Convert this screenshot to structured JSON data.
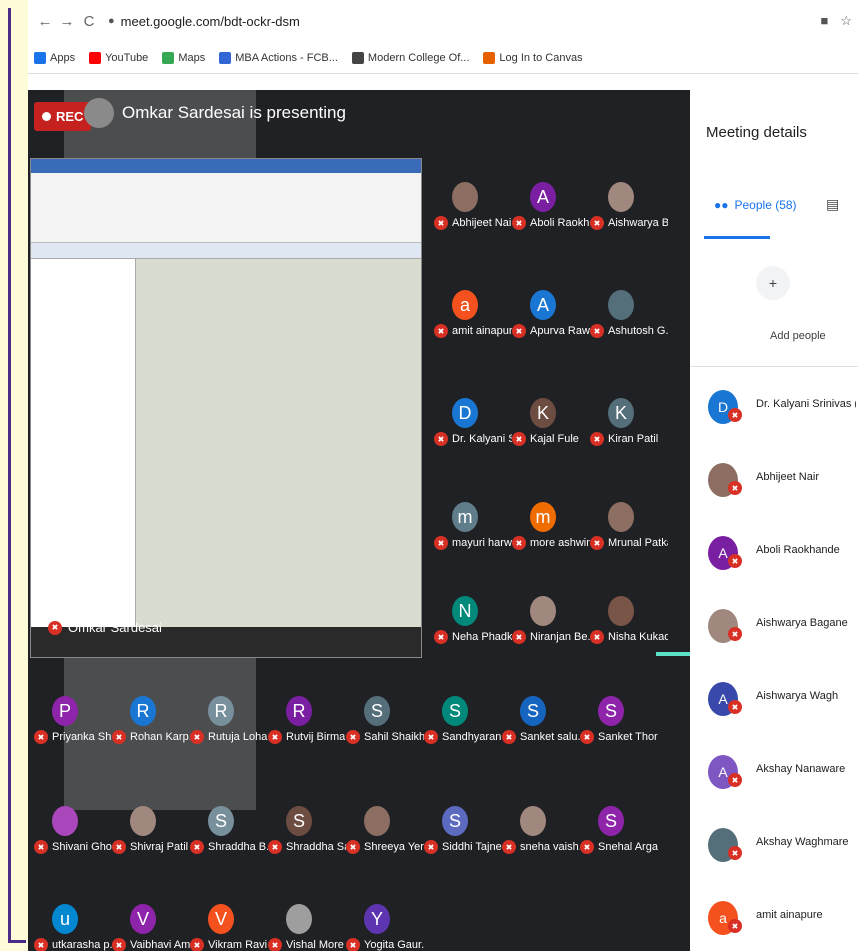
{
  "browser": {
    "url": "meet.google.com/bdt-ockr-dsm",
    "back_icon": "←",
    "forward_icon": "→",
    "reload_icon": "C",
    "bookmarks": [
      {
        "label": "Apps",
        "color": "#1a73e8"
      },
      {
        "label": "YouTube",
        "color": "#ff0000"
      },
      {
        "label": "Maps",
        "color": "#34a853"
      },
      {
        "label": "MBA Actions - FCB...",
        "color": "#3367d6"
      },
      {
        "label": "Modern College Of...",
        "color": "#444444"
      },
      {
        "label": "Log In to Canvas",
        "color": "#e66000"
      }
    ]
  },
  "meeting": {
    "rec_label": "REC",
    "presenting_text": "Omkar Sardesai is presenting",
    "own_tile_label": "Omkar Sardesai",
    "participants": [
      {
        "name": "Abhijeet Nair",
        "initial": "",
        "color": "#8d6e63"
      },
      {
        "name": "Aboli Raokh...",
        "initial": "A",
        "color": "#7b1fa2"
      },
      {
        "name": "Aishwarya B...",
        "initial": "",
        "color": "#a1887f"
      },
      {
        "name": "amit ainapure",
        "initial": "a",
        "color": "#f4511e"
      },
      {
        "name": "Apurva Rawal",
        "initial": "A",
        "color": "#1976d2"
      },
      {
        "name": "Ashutosh G...",
        "initial": "",
        "color": "#546e7a"
      },
      {
        "name": "Dr. Kalyani S...",
        "initial": "D",
        "color": "#1976d2"
      },
      {
        "name": "Kajal Fule",
        "initial": "K",
        "color": "#6d4c41"
      },
      {
        "name": "Kiran Patil",
        "initial": "K",
        "color": "#546e7a"
      },
      {
        "name": "mayuri harw...",
        "initial": "m",
        "color": "#607d8b"
      },
      {
        "name": "more ashwini",
        "initial": "m",
        "color": "#ef6c00"
      },
      {
        "name": "Mrunal Patkar",
        "initial": "",
        "color": "#8d6e63"
      },
      {
        "name": "Neha Phadke",
        "initial": "N",
        "color": "#00897b"
      },
      {
        "name": "Niranjan Be...",
        "initial": "",
        "color": "#a1887f"
      },
      {
        "name": "Nisha Kukade",
        "initial": "",
        "color": "#795548"
      },
      {
        "name": "Priyanka Shr...",
        "initial": "P",
        "color": "#8e24aa"
      },
      {
        "name": "Rohan Karp...",
        "initial": "R",
        "color": "#1976d2"
      },
      {
        "name": "Rutuja Lohar",
        "initial": "R",
        "color": "#78909c"
      },
      {
        "name": "Rutvij Birmal",
        "initial": "R",
        "color": "#7b1fa2"
      },
      {
        "name": "Sahil Shaikh",
        "initial": "S",
        "color": "#546e7a"
      },
      {
        "name": "Sandhyarani...",
        "initial": "S",
        "color": "#00897b"
      },
      {
        "name": "Sanket salu...",
        "initial": "S",
        "color": "#1565c0"
      },
      {
        "name": "Sanket Thorat",
        "initial": "S",
        "color": "#8e24aa"
      },
      {
        "name": "Shivani Gho...",
        "initial": "",
        "color": "#ab47bc"
      },
      {
        "name": "Shivraj Patil",
        "initial": "",
        "color": "#a1887f"
      },
      {
        "name": "Shraddha B...",
        "initial": "S",
        "color": "#78909c"
      },
      {
        "name": "Shraddha Sa...",
        "initial": "S",
        "color": "#6d4c41"
      },
      {
        "name": "Shreeya Yer...",
        "initial": "",
        "color": "#8d6e63"
      },
      {
        "name": "Siddhi Tajne",
        "initial": "S",
        "color": "#5c6bc0"
      },
      {
        "name": "sneha vaish...",
        "initial": "",
        "color": "#a1887f"
      },
      {
        "name": "Snehal Arga...",
        "initial": "S",
        "color": "#8e24aa"
      },
      {
        "name": "utkarasha p...",
        "initial": "u",
        "color": "#0288d1"
      },
      {
        "name": "Vaibhavi Am...",
        "initial": "V",
        "color": "#8e24aa"
      },
      {
        "name": "Vikram Ravi...",
        "initial": "V",
        "color": "#f4511e"
      },
      {
        "name": "Vishal More",
        "initial": "",
        "color": "#9e9e9e"
      },
      {
        "name": "Yogita Gaur...",
        "initial": "Y",
        "color": "#5e35b1"
      }
    ]
  },
  "panel": {
    "title": "Meeting details",
    "people_tab": "People (58)",
    "add_people_label": "Add people",
    "people": [
      {
        "name": "Dr. Kalyani Srinivas (You)",
        "initial": "D",
        "color": "#1976d2"
      },
      {
        "name": "Abhijeet Nair",
        "initial": "",
        "color": "#8d6e63"
      },
      {
        "name": "Aboli Raokhande",
        "initial": "A",
        "color": "#7b1fa2"
      },
      {
        "name": "Aishwarya Bagane",
        "initial": "",
        "color": "#a1887f"
      },
      {
        "name": "Aishwarya Wagh",
        "initial": "A",
        "color": "#3949ab"
      },
      {
        "name": "Akshay Nanaware",
        "initial": "A",
        "color": "#7e57c2"
      },
      {
        "name": "Akshay Waghmare",
        "initial": "",
        "color": "#546e7a"
      },
      {
        "name": "amit ainapure",
        "initial": "a",
        "color": "#f4511e"
      }
    ]
  }
}
